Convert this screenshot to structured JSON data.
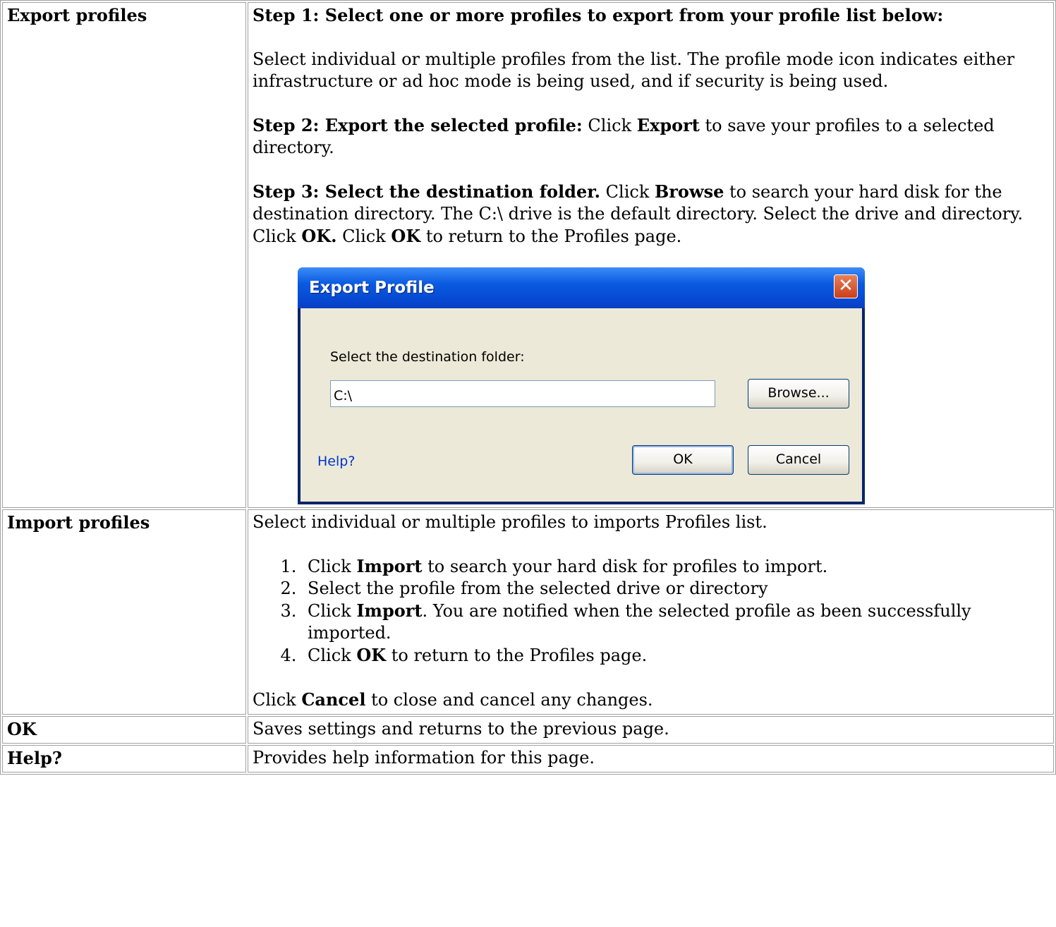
{
  "rows": {
    "export": {
      "label": "Export profiles",
      "step1_title": "Step 1: Select one or more profiles to export from your profile list below:",
      "step1_text": "Select individual or multiple profiles from the list. The profile mode icon indicates either infrastructure or ad hoc mode is being used, and if security is being used.",
      "step2_title": "Step 2: Export the selected profile:",
      "step2_pre": " Click ",
      "step2_bold": "Export",
      "step2_post": " to save your profiles to a selected directory.",
      "step3_title": "Step 3: Select the destination folder.",
      "step3_pre": " Click ",
      "step3_bold1": "Browse",
      "step3_mid1": " to search your hard disk for the destination directory. The C:\\ drive is the default directory. Select the drive and directory. Click ",
      "step3_bold2": "OK.",
      "step3_mid2": " Click ",
      "step3_bold3": "OK",
      "step3_post": " to return to the Profiles page."
    },
    "import": {
      "label": "Import profiles",
      "intro": "Select individual or multiple profiles to imports Profiles list.",
      "step1_pre": "Click ",
      "step1_bold": "Import",
      "step1_post": " to search your hard disk for profiles to import.",
      "step2": "Select the profile from the selected drive or directory",
      "step3_pre": "Click ",
      "step3_bold": "Import",
      "step3_post": ". You are notified when the selected profile as been successfully imported.",
      "step4_pre": "Click ",
      "step4_bold": "OK",
      "step4_post": " to return to the Profiles page.",
      "cancel_pre": "Click ",
      "cancel_bold": "Cancel",
      "cancel_post": " to close and cancel any changes."
    },
    "ok": {
      "label": "OK",
      "text": "Saves settings and returns to the previous page."
    },
    "help": {
      "label": "Help?",
      "text": "Provides help information for this page."
    }
  },
  "dialog": {
    "title": "Export Profile",
    "close_glyph": "✕",
    "prompt": "Select the destination folder:",
    "path_value": "C:\\",
    "browse_label": "Browse...",
    "help_link": "Help?",
    "ok_label": "OK",
    "cancel_label": "Cancel"
  }
}
